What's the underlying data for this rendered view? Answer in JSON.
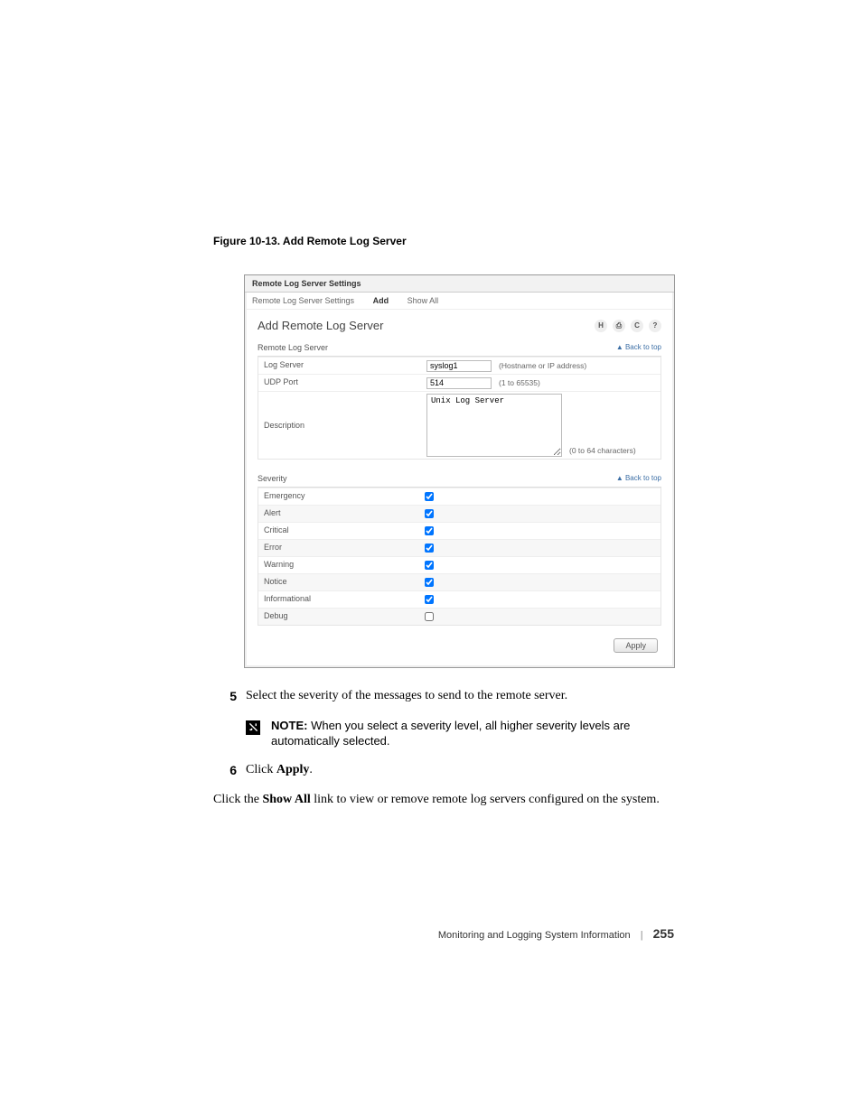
{
  "figure_caption": "Figure 10-13.    Add Remote Log Server",
  "screenshot": {
    "header_title": "Remote Log Server Settings",
    "tabs": {
      "settings": "Remote Log Server Settings",
      "add": "Add",
      "show_all": "Show All"
    },
    "page_title": "Add Remote Log Server",
    "icons": {
      "save": "H",
      "print": "⎙",
      "refresh": "C",
      "help": "?"
    },
    "section_remote": {
      "title": "Remote Log Server",
      "back_to_top": "▲ Back to top",
      "rows": {
        "log_server": {
          "label": "Log Server",
          "value": "syslog1",
          "hint": "(Hostname or IP address)"
        },
        "udp_port": {
          "label": "UDP Port",
          "value": "514",
          "hint": "(1 to 65535)"
        },
        "description": {
          "label": "Description",
          "value": "Unix Log Server",
          "hint": "(0 to 64 characters)"
        }
      }
    },
    "section_severity": {
      "title": "Severity",
      "back_to_top": "▲ Back to top",
      "levels": [
        {
          "label": "Emergency",
          "checked": true
        },
        {
          "label": "Alert",
          "checked": true
        },
        {
          "label": "Critical",
          "checked": true
        },
        {
          "label": "Error",
          "checked": true
        },
        {
          "label": "Warning",
          "checked": true
        },
        {
          "label": "Notice",
          "checked": true
        },
        {
          "label": "Informational",
          "checked": true
        },
        {
          "label": "Debug",
          "checked": false
        }
      ]
    },
    "apply_button": "Apply"
  },
  "steps": {
    "five": {
      "num": "5",
      "text": "Select the severity of the messages to send to the remote server."
    },
    "note": {
      "label": "NOTE:",
      "text": " When you select a severity level, all higher severity levels are automatically selected."
    },
    "six": {
      "num": "6",
      "prefix": "Click ",
      "bold": "Apply",
      "suffix": "."
    }
  },
  "paragraph": {
    "p1": "Click the ",
    "b1": "Show All",
    "p2": " link to view or remove remote log servers configured on the system."
  },
  "footer": {
    "chapter": "Monitoring and Logging System Information",
    "page": "255"
  }
}
